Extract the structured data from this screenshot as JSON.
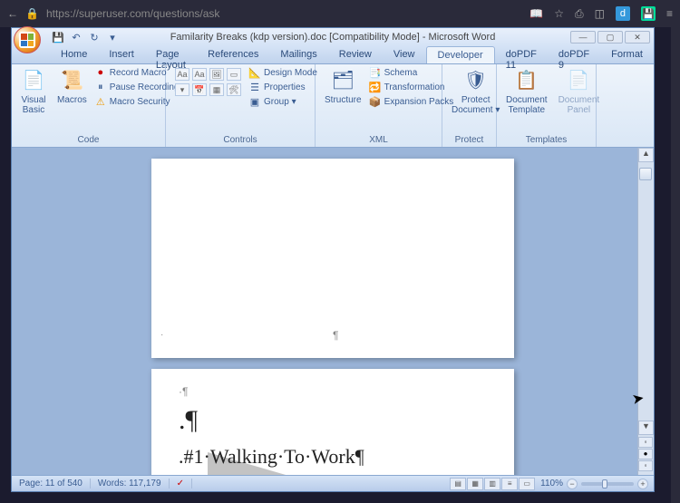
{
  "browser": {
    "url": "https://superuser.com/questions/ask",
    "icons": {
      "back": "←",
      "lock": "🔒",
      "readmode": "📖",
      "star": "☆",
      "library": "⎙",
      "reader": "◫",
      "d": "d",
      "save": "💾",
      "menu": "≡"
    }
  },
  "title": "Familarity Breaks (kdp version).doc [Compatibility Mode] - Microsoft Word",
  "qat": {
    "save": "💾",
    "undo": "↶",
    "redo": "↻",
    "more": "▾"
  },
  "win": {
    "min": "—",
    "max": "▢",
    "close": "✕"
  },
  "tabs": [
    "Home",
    "Insert",
    "Page Layout",
    "References",
    "Mailings",
    "Review",
    "View",
    "Developer",
    "doPDF 11",
    "doPDF 9",
    "Format"
  ],
  "active_tab": 7,
  "ribbon": {
    "code": {
      "label": "Code",
      "visual_basic": "Visual\nBasic",
      "macros": "Macros",
      "record": "Record Macro",
      "pause": "Pause Recording",
      "security": "Macro Security"
    },
    "controls": {
      "label": "Controls",
      "design": "Design Mode",
      "properties": "Properties",
      "group": "Group ▾"
    },
    "xml": {
      "label": "XML",
      "structure": "Structure",
      "schema": "Schema",
      "transformation": "Transformation",
      "expansion": "Expansion Packs"
    },
    "protect": {
      "label": "Protect",
      "button": "Protect\nDocument ▾"
    },
    "templates": {
      "label": "Templates",
      "doc_template": "Document\nTemplate",
      "doc_panel": "Document\nPanel"
    }
  },
  "document": {
    "page1_paragraph": "¶",
    "page1_dot": "·",
    "page2_line1": "·¶",
    "page2_line2": ".¶",
    "page2_line3": ".#1·Walking·To·Work¶"
  },
  "status": {
    "page": "Page: 11 of 540",
    "words": "Words: 117,179",
    "proof": "✓",
    "zoom_pct": "110%",
    "zoom_minus": "−",
    "zoom_plus": "+"
  }
}
